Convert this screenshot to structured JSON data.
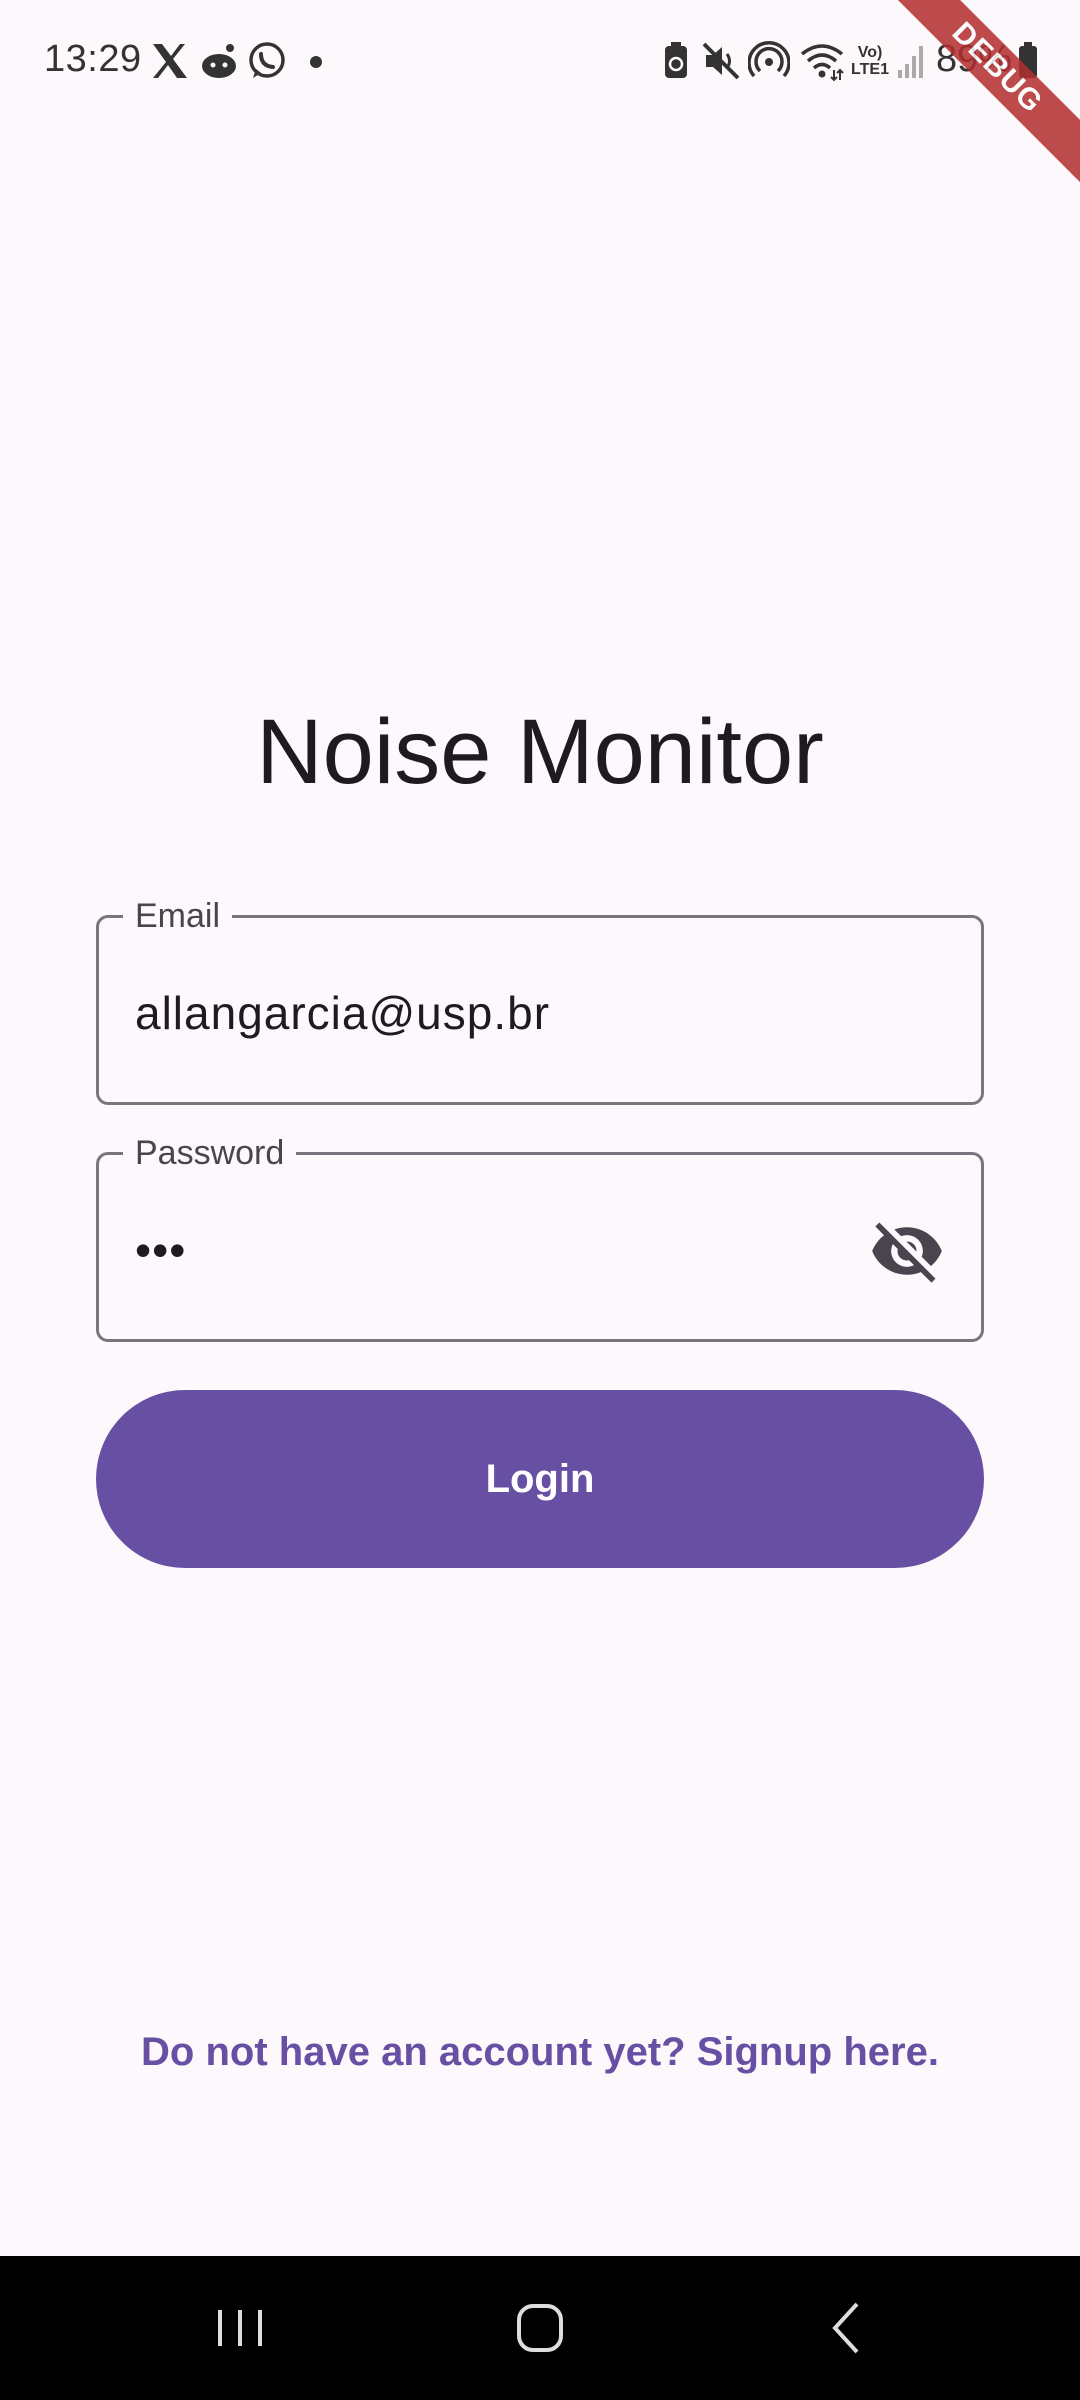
{
  "status_bar": {
    "time": "13:29",
    "notification_icons": [
      "x-icon",
      "reddit-icon",
      "whatsapp-icon",
      "dot-icon"
    ],
    "system_icons": [
      "battery-saver-icon",
      "mute-icon",
      "hotspot-icon",
      "wifi-icon",
      "volte-icon",
      "signal-icon"
    ],
    "volte_label": "Vo) LTE1",
    "battery": "89%"
  },
  "debug_banner": "DEBUG",
  "title": "Noise Monitor",
  "email": {
    "label": "Email",
    "value": "allangarcia@usp.br"
  },
  "password": {
    "label": "Password",
    "value": "•••",
    "toggle_icon": "visibility-off-icon"
  },
  "login_button": "Login",
  "signup_link": "Do not have an account yet? Signup here.",
  "colors": {
    "primary": "#6750a4",
    "background": "#fdf8fc",
    "outline": "#79747e",
    "debug": "#b22e2e"
  },
  "nav_bar": {
    "buttons": [
      "recents-icon",
      "home-icon",
      "back-icon"
    ]
  }
}
